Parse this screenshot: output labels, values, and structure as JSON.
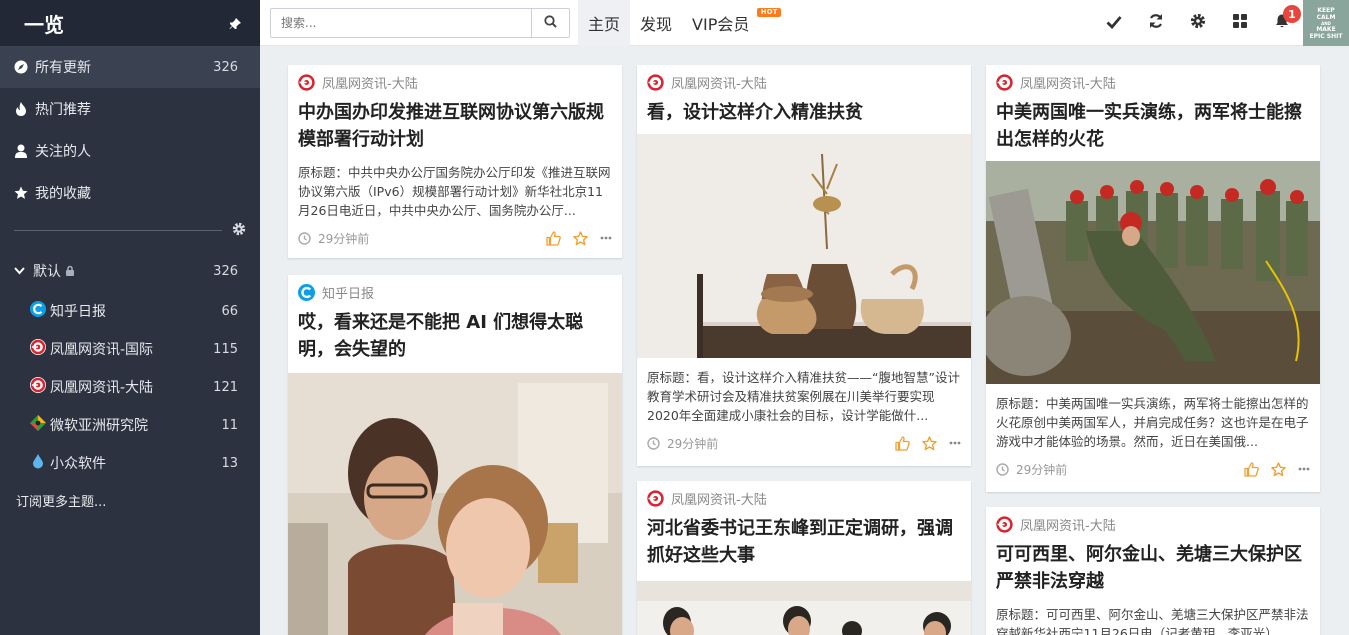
{
  "sidebar": {
    "title": "一览",
    "main_items": [
      {
        "label": "所有更新",
        "count": "326"
      },
      {
        "label": "热门推荐",
        "count": ""
      },
      {
        "label": "关注的人",
        "count": ""
      },
      {
        "label": "我的收藏",
        "count": ""
      }
    ],
    "group": {
      "label": "默认",
      "count": "326"
    },
    "feeds": [
      {
        "label": "知乎日报",
        "count": "66"
      },
      {
        "label": "凤凰网资讯-国际",
        "count": "115"
      },
      {
        "label": "凤凰网资讯-大陆",
        "count": "121"
      },
      {
        "label": "微软亚洲研究院",
        "count": "11"
      },
      {
        "label": "小众软件",
        "count": "13"
      }
    ],
    "more": "订阅更多主题..."
  },
  "topbar": {
    "search_placeholder": "搜索...",
    "tabs": [
      "主页",
      "发现",
      "VIP会员"
    ],
    "hot": "HOT",
    "notif_count": "1",
    "keep_lines": [
      "KEEP",
      "CALM",
      "AND",
      "MAKE",
      "EPIC SHIT"
    ]
  },
  "cards": [
    {
      "source": "凤凰网资讯-大陆",
      "title": "中办国办印发推进互联网协议第六版规模部署行动计划",
      "desc": "原标题：中共中央办公厅国务院办公厅印发《推进互联网协议第六版（IPv6）规模部署行动计划》新华社北京11月26日电近日，中共中央办公厅、国务院办公厅...",
      "time": "29分钟前"
    },
    {
      "source": "知乎日报",
      "title": "哎，看来还是不能把 AI 们想得太聪明，会失望的"
    },
    {
      "source": "凤凰网资讯-大陆",
      "title": "看，设计这样介入精准扶贫",
      "desc": "原标题：看，设计这样介入精准扶贫——“腹地智慧”设计教育学术研讨会及精准扶贫案例展在川美举行要实现2020年全面建成小康社会的目标，设计学能做什...",
      "time": "29分钟前"
    },
    {
      "source": "凤凰网资讯-大陆",
      "title": "河北省委书记王东峰到正定调研，强调抓好这些大事"
    },
    {
      "source": "凤凰网资讯-大陆",
      "title": "中美两国唯一实兵演练，两军将士能擦出怎样的火花",
      "desc": "原标题：中美两国唯一实兵演练，两军将士能擦出怎样的火花原创中美两国军人，并肩完成任务？这也许是在电子游戏中才能体验的场景。然而，近日在美国俄...",
      "time": "29分钟前"
    },
    {
      "source": "凤凰网资讯-大陆",
      "title": "可可西里、阿尔金山、羌塘三大保护区严禁非法穿越",
      "desc": "原标题：可可西里、阿尔金山、羌塘三大保护区严禁非法穿越新华社西宁11月26日电（记者黄玥、李亚光）"
    }
  ]
}
